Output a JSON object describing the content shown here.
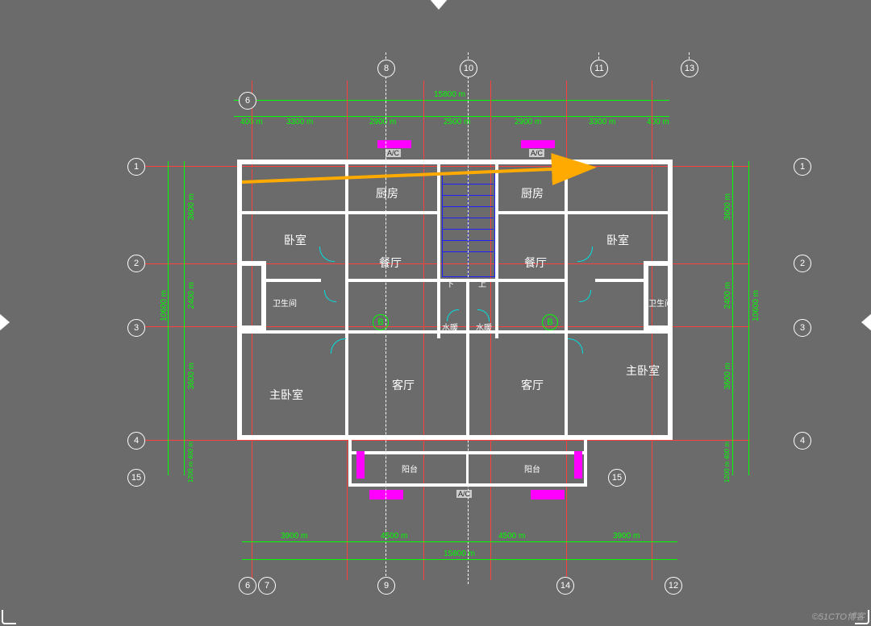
{
  "watermark": "©51CTO博客",
  "rooms": {
    "kitchen_l": "厨房",
    "kitchen_r": "厨房",
    "bedroom_l": "卧室",
    "bedroom_r": "卧室",
    "dining_l": "餐厅",
    "dining_r": "餐厅",
    "bath_l": "卫生间",
    "bath_r": "卫生间",
    "living_l": "客厅",
    "living_r": "客厅",
    "master_l": "主卧室",
    "master_r": "主卧室",
    "balcony_l": "阳台",
    "balcony_r": "阳台",
    "down": "下",
    "up": "上",
    "wc_mark_l": "水暖",
    "wc_mark_r": "水暖",
    "ac_l": "A/C",
    "ac_r": "A/C",
    "ac_b": "A/C",
    "B_l": "B",
    "B_r": "B"
  },
  "dims_top": {
    "d1": "400 m",
    "d2": "3300 m",
    "d3": "2900 m",
    "d4": "2500 m",
    "d5": "2900 m",
    "d6": "3300 m",
    "d7": "400 m",
    "total": "15800 m"
  },
  "dims_bottom": {
    "d1": "3900 m",
    "d2": "4500 m",
    "d3": "4500 m",
    "d4": "3900 m",
    "total": "15800 m"
  },
  "dims_left": {
    "d1": "3600 m",
    "d2": "2400 m",
    "d3": "3600 m",
    "d4": "1200 m 400 m",
    "total": "10600 m"
  },
  "dims_right": {
    "d1": "3600 m",
    "d2": "2400 m",
    "d3": "3600 m",
    "d4": "1200 m 400 m",
    "total": "10600 m"
  },
  "grids_h": {
    "g1": "1",
    "g2": "2",
    "g3": "3",
    "g4": "4",
    "g15": "15"
  },
  "grids_v": {
    "g6": "6",
    "g7": "7",
    "g8": "8",
    "g9": "9",
    "g10": "10",
    "g11": "11",
    "g12": "12",
    "g13": "13",
    "g14": "14"
  }
}
